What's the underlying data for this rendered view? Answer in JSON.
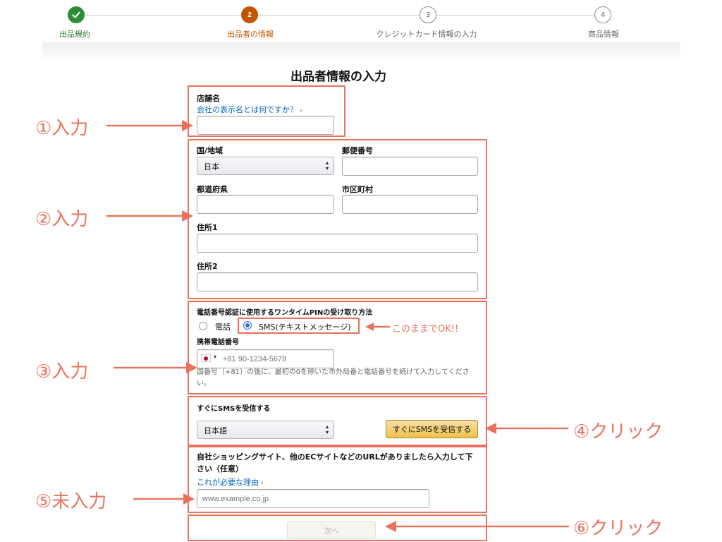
{
  "stepper": {
    "steps": [
      {
        "label": "出品規約",
        "number": "",
        "status": "done"
      },
      {
        "label": "出品者の情報",
        "number": "2",
        "status": "current"
      },
      {
        "label": "クレジットカード情報の入力",
        "number": "3",
        "status": "pending"
      },
      {
        "label": "商品情報",
        "number": "4",
        "status": "pending"
      }
    ]
  },
  "form": {
    "title": "出品者情報の入力",
    "store_name": {
      "label": "店舗名",
      "link": "会社の表示名とは何ですか？",
      "value": ""
    },
    "address": {
      "country_label": "国/地域",
      "country_value": "日本",
      "zip_label": "郵便番号",
      "prefecture_label": "都道府県",
      "city_label": "市区町村",
      "address1_label": "住所1",
      "address2_label": "住所2"
    },
    "phone": {
      "method_label": "電話番号認証に使用するワンタイムPINの受け取り方法",
      "option_phone": "電話",
      "option_sms": "SMS(テキストメッセージ)",
      "selected": "sms",
      "mobile_label": "携帯電話番号",
      "mobile_placeholder": "+81 90-1234-5678",
      "hint": "国番号（+81）の後に、最初の0を除いた市外局番と電話番号を続けて入力してください。"
    },
    "sms": {
      "label": "すぐにSMSを受信する",
      "language_value": "日本語",
      "button": "すぐにSMSを受信する"
    },
    "url": {
      "label": "自社ショッピングサイト、他のECサイトなどのURLがありましたら入力して下さい（任意）",
      "link": "これが必要な理由",
      "placeholder": "www.example.co.jp"
    },
    "next_button": "次へ"
  },
  "annotations": {
    "a1": "①入力",
    "a2": "②入力",
    "a3": "③入力",
    "a4": "④クリック",
    "a5": "⑤未入力",
    "a6": "⑥クリック",
    "ok_note": "このままでOK!!"
  },
  "colors": {
    "annotation_red": "#e8725c",
    "step_done": "#2e8b3a",
    "step_current": "#c45500",
    "link_blue": "#0066c0",
    "radio_blue": "#2d6ad6"
  }
}
